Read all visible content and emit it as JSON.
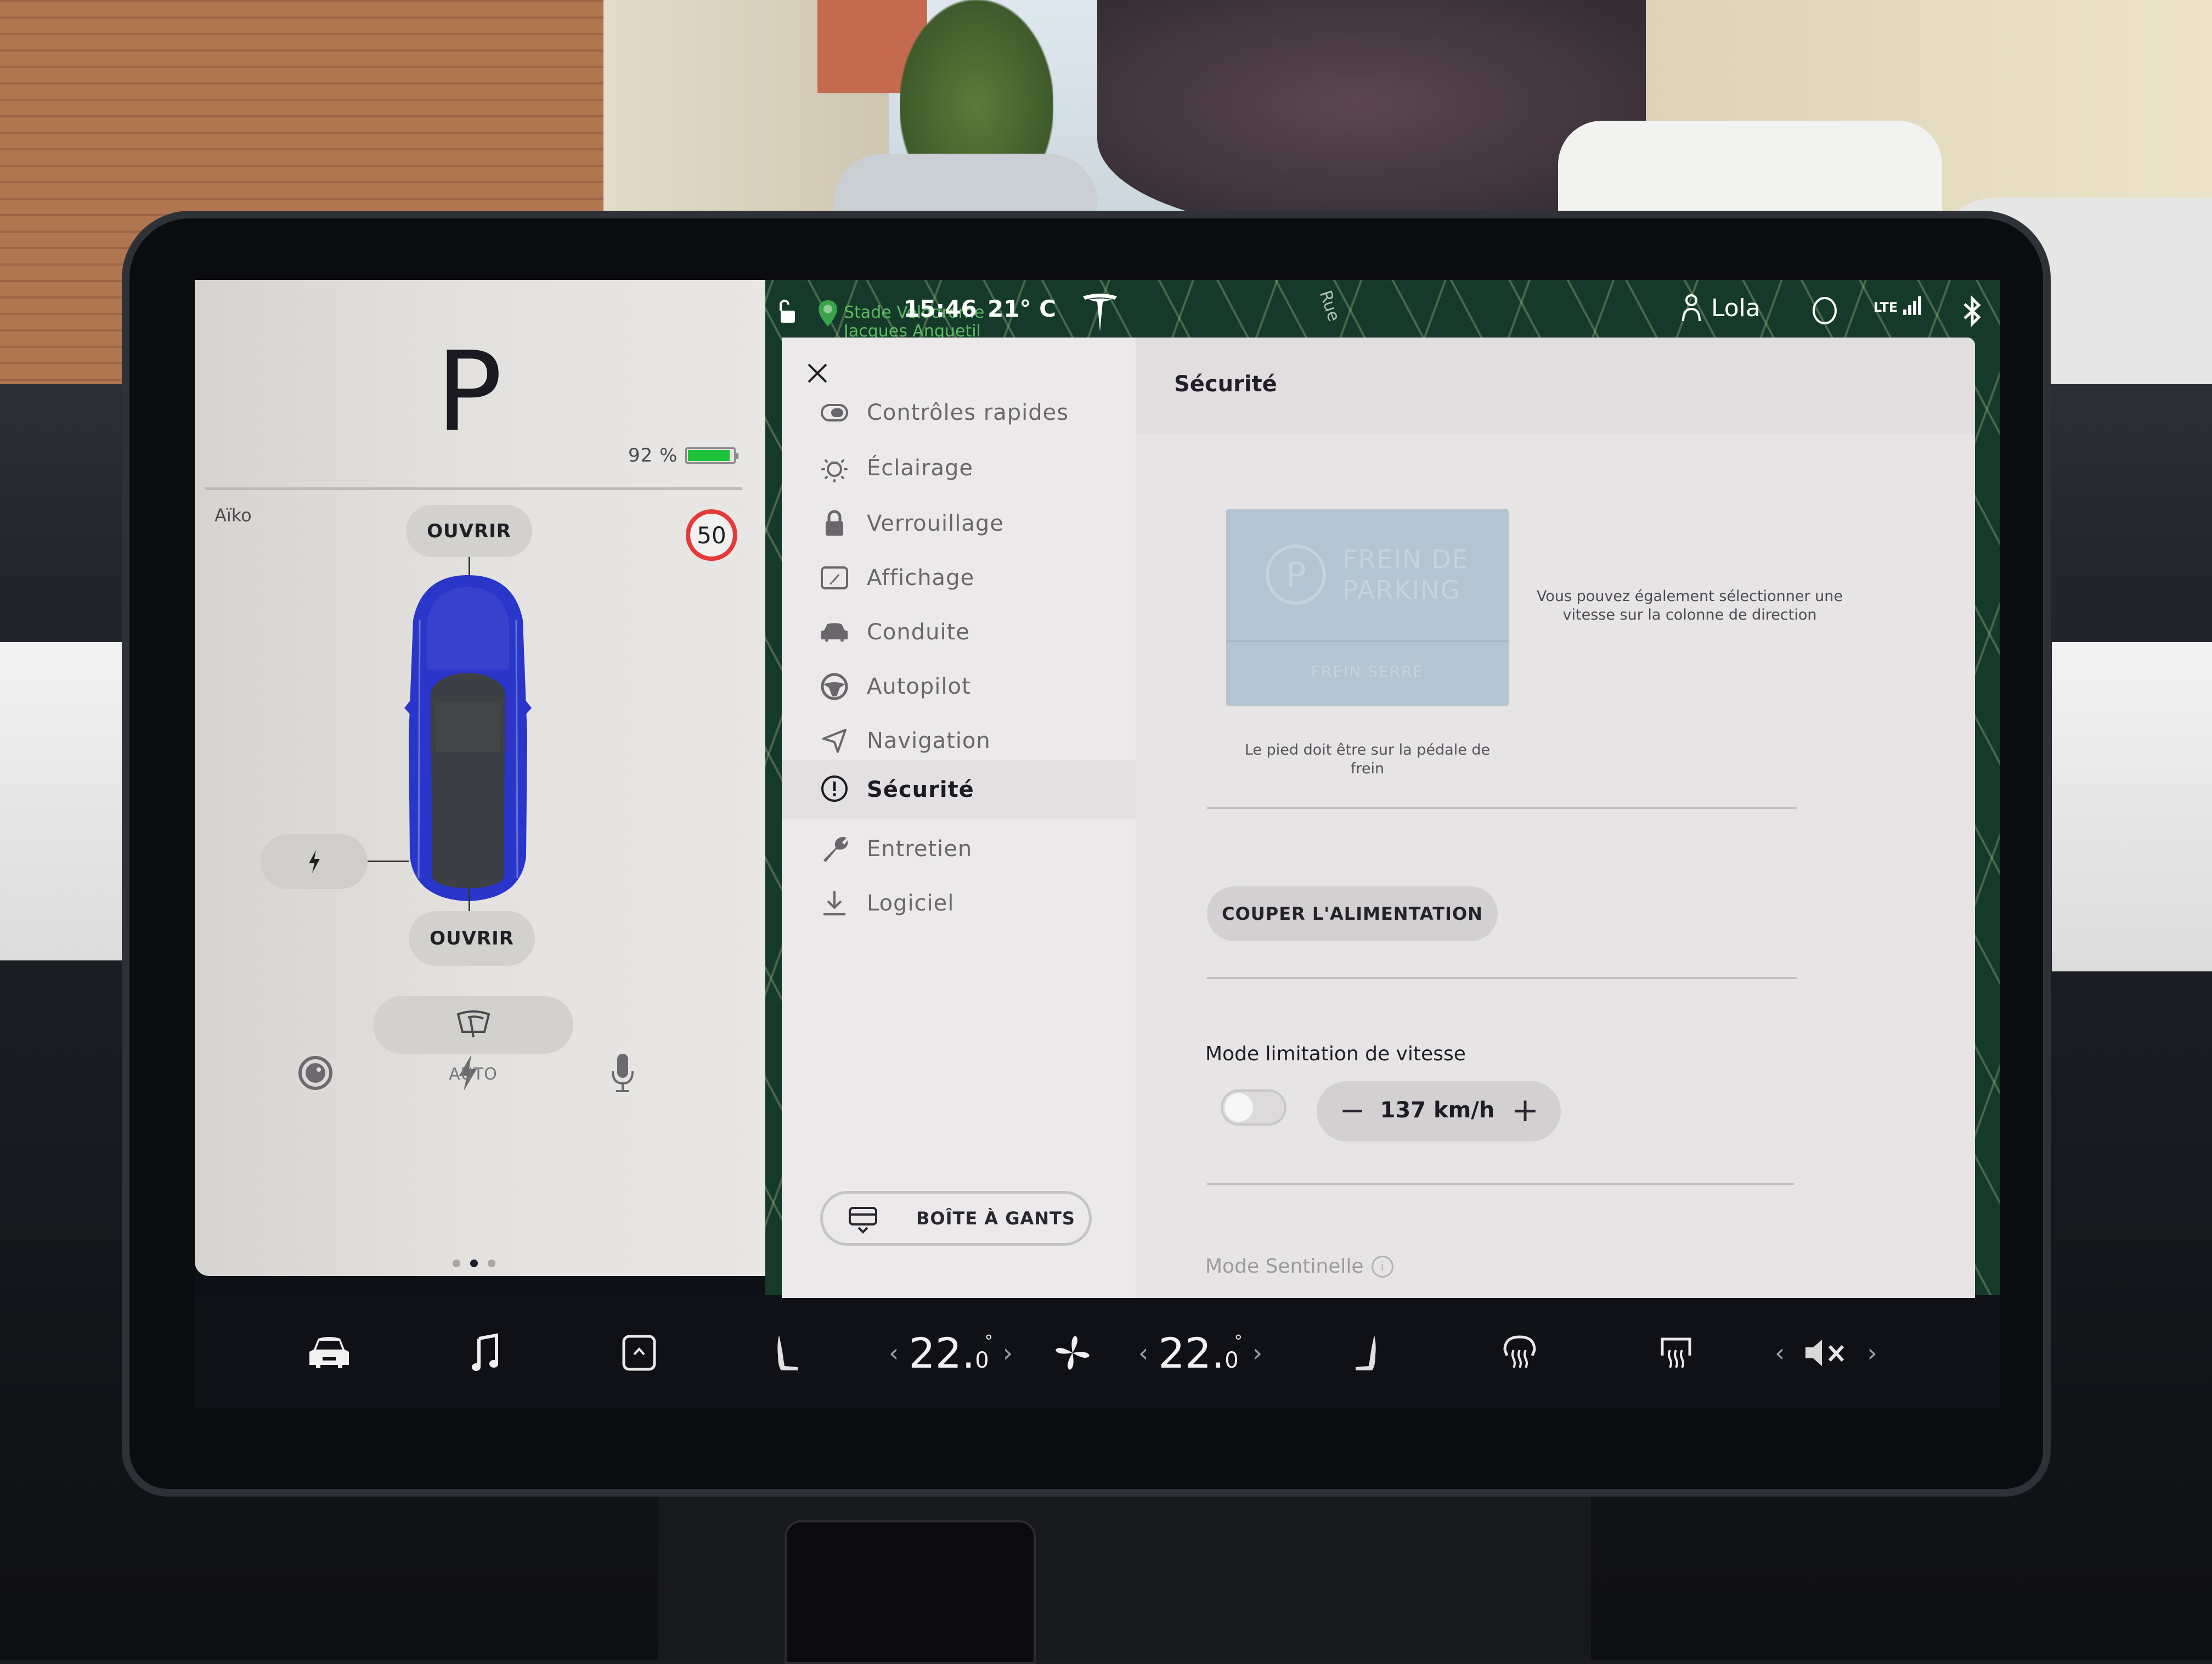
{
  "status_bar": {
    "clock": "15:46",
    "outside_temp": "21° C",
    "map_poi_label": "Stade Vélodrome Jacques Anquetil",
    "map_road_label": "Rue",
    "profile_name": "Lola",
    "network": "LTE",
    "signal_bars": 4,
    "icons": [
      "lock-icon",
      "map-pin-icon",
      "tesla-logo-icon",
      "profile-icon",
      "dashcam-icon",
      "signal-icon",
      "bluetooth-icon"
    ]
  },
  "car_panel": {
    "gear": "P",
    "battery_percent": 92,
    "battery_label": "92 %",
    "battery_color": "#1fc23a",
    "driver_name": "Aïko",
    "frunk_label": "OUVRIR",
    "trunk_label": "OUVRIR",
    "speed_limit": "50",
    "speed_limit_color": "#e53a3a",
    "car_color": "#2a35c9",
    "quick_icons": [
      "dashcam-icon",
      "lightning-icon",
      "microphone-icon"
    ],
    "wiper_label": "AUTO",
    "page_dots": {
      "count": 3,
      "active": 2
    }
  },
  "settings": {
    "close_label": "×",
    "menu": [
      {
        "label": "Contrôles rapides",
        "icon": "toggle-icon",
        "active": false
      },
      {
        "label": "Éclairage",
        "icon": "bulb-icon",
        "active": false
      },
      {
        "label": "Verrouillage",
        "icon": "lock-icon",
        "active": false
      },
      {
        "label": "Affichage",
        "icon": "display-icon",
        "active": false
      },
      {
        "label": "Conduite",
        "icon": "car-icon",
        "active": false
      },
      {
        "label": "Autopilot",
        "icon": "steering-wheel-icon",
        "active": false
      },
      {
        "label": "Navigation",
        "icon": "navigation-arrow-icon",
        "active": false
      },
      {
        "label": "Sécurité",
        "icon": "alert-circle-icon",
        "active": true
      },
      {
        "label": "Entretien",
        "icon": "wrench-icon",
        "active": false
      },
      {
        "label": "Logiciel",
        "icon": "download-icon",
        "active": false
      }
    ],
    "glovebox_label": "BOÎTE À GANTS",
    "content": {
      "title": "Sécurité",
      "park_brake": {
        "symbol": "P",
        "title_line1": "FREIN DE",
        "title_line2": "PARKING",
        "status": "FREIN SERRÉ",
        "caption": "Le pied doit être sur la pédale de frein"
      },
      "column_hint": "Vous pouvez également sélectionner une vitesse sur la colonne de direction",
      "power_off_label": "COUPER L'ALIMENTATION",
      "speed_limit_mode": {
        "label": "Mode limitation de vitesse",
        "enabled": false,
        "minus_label": "−",
        "value": "137 km/h",
        "plus_label": "+"
      },
      "sentry_mode_label": "Mode Sentinelle",
      "sentry_info_label": "i"
    }
  },
  "bottom_bar": {
    "icons": [
      "car-icon",
      "music-note-icon",
      "app-launcher-icon",
      "driver-seat-heat-icon",
      "fan-icon",
      "passenger-seat-heat-icon",
      "front-defrost-icon",
      "rear-defrost-icon",
      "volume-muted-icon"
    ],
    "driver_temp": "22.0",
    "driver_temp_int": "22.",
    "driver_temp_dec": "0",
    "passenger_temp": "22.0",
    "passenger_temp_int": "22.",
    "passenger_temp_dec": "0",
    "degree_symbol": "°",
    "chevron_left": "‹",
    "chevron_right": "›"
  }
}
